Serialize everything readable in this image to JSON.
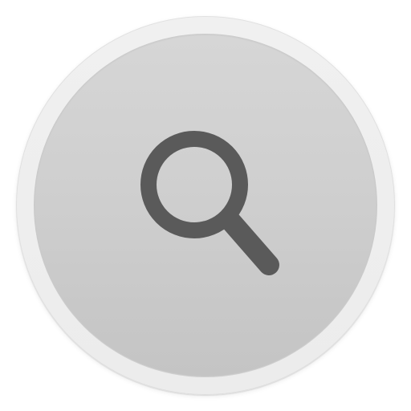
{
  "app": {
    "name": "Search"
  },
  "button": {
    "icon": "magnifying-glass",
    "outer_ring_color": "#EEEEEE",
    "inner_fill_top": "#D6D6D6",
    "inner_fill_bottom": "#C4C4C4",
    "icon_color": "#5A5A5A"
  }
}
